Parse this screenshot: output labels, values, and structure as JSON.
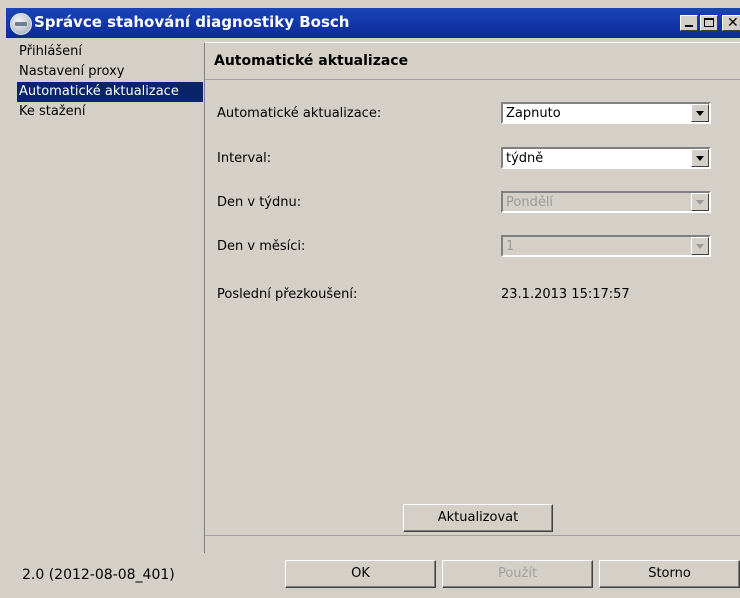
{
  "window": {
    "title": "Správce stahování diagnostiky Bosch",
    "app_icon": "bosch-logo-icon",
    "minimize_icon": "minimize-icon",
    "maximize_icon": "maximize-icon",
    "close_icon": "close-icon",
    "close_glyph": "✕"
  },
  "sidebar": {
    "items": [
      {
        "label": "Přihlášení"
      },
      {
        "label": "Nastavení proxy"
      },
      {
        "label": "Automatické aktualizace",
        "selected": true
      },
      {
        "label": "Ke stažení"
      }
    ]
  },
  "panel": {
    "header": "Automatické aktualizace",
    "rows": {
      "auto_update": {
        "label": "Automatické aktualizace:",
        "value": "Zapnuto"
      },
      "interval": {
        "label": "Interval:",
        "value": "týdně"
      },
      "day_of_week": {
        "label": "Den v týdnu:",
        "value": "Pondělí",
        "disabled": true
      },
      "day_of_month": {
        "label": "Den v měsíci:",
        "value": "1",
        "disabled": true
      },
      "last_check": {
        "label": "Poslední přezkoušení:",
        "value": "23.1.2013 15:17:57"
      }
    },
    "update_button": "Aktualizovat"
  },
  "footer": {
    "version": "2.0 (2012-08-08_401)",
    "ok": "OK",
    "apply": "Použít",
    "cancel": "Storno"
  }
}
